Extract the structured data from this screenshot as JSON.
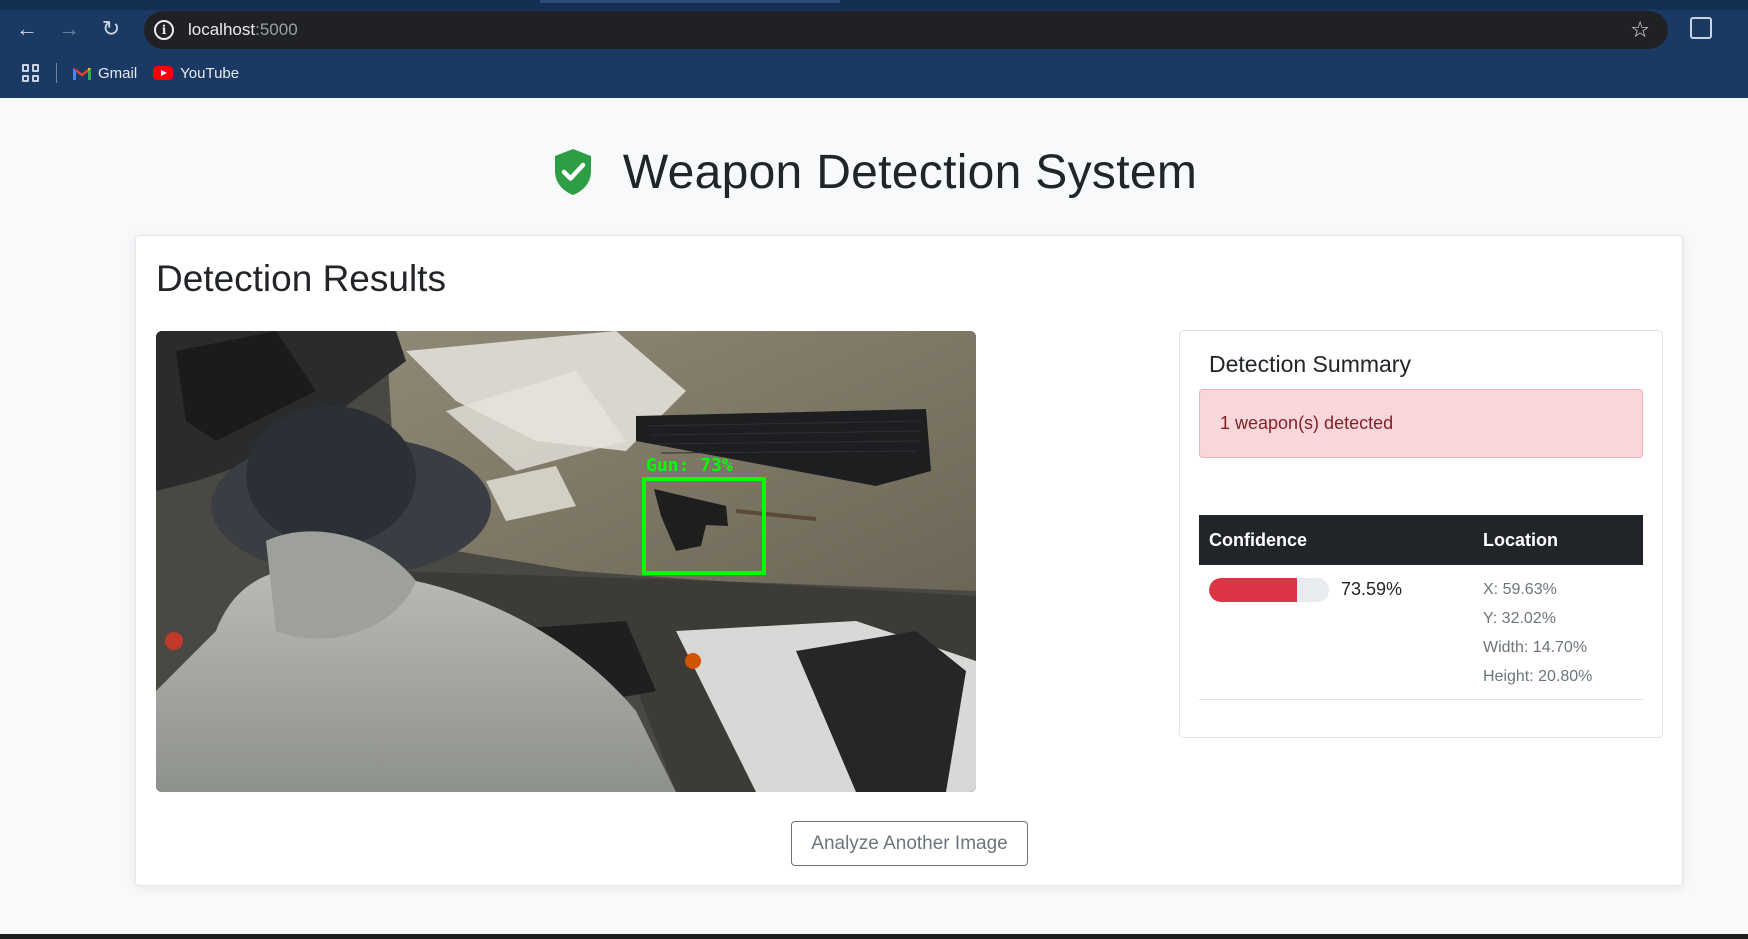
{
  "browser": {
    "url_host": "localhost",
    "url_port": ":5000",
    "bookmarks": [
      {
        "label": "Gmail",
        "icon": "gmail-icon"
      },
      {
        "label": "YouTube",
        "icon": "youtube-icon"
      }
    ],
    "icons": {
      "back": "back-arrow-icon",
      "forward": "forward-arrow-icon",
      "reload": "reload-icon",
      "site_info": "info-icon",
      "bookmark": "star-icon",
      "extensions": "extensions-icon",
      "apps": "apps-grid-icon"
    }
  },
  "header": {
    "title": "Weapon Detection System",
    "icon": "shield-check-icon",
    "icon_color": "#2e9e44"
  },
  "results": {
    "title": "Detection Results",
    "image": {
      "alt": "Annotated surveillance frame",
      "detection_label": "Gun: 73%",
      "box_color": "#00ff00"
    },
    "summary": {
      "title": "Detection Summary",
      "alert_text": "1 weapon(s) detected",
      "alert_color": "#f8d7da",
      "table": {
        "headers": [
          "Confidence",
          "Location"
        ],
        "rows": [
          {
            "confidence_fraction": 0.7359,
            "confidence_text": "73.59%",
            "location": [
              "X: 59.63%",
              "Y: 32.02%",
              "Width: 14.70%",
              "Height: 20.80%"
            ]
          }
        ]
      }
    },
    "action_button": "Analyze Another Image"
  },
  "colors": {
    "danger": "#dc3545",
    "table_header": "#212529",
    "chrome": "#1b3a63"
  }
}
